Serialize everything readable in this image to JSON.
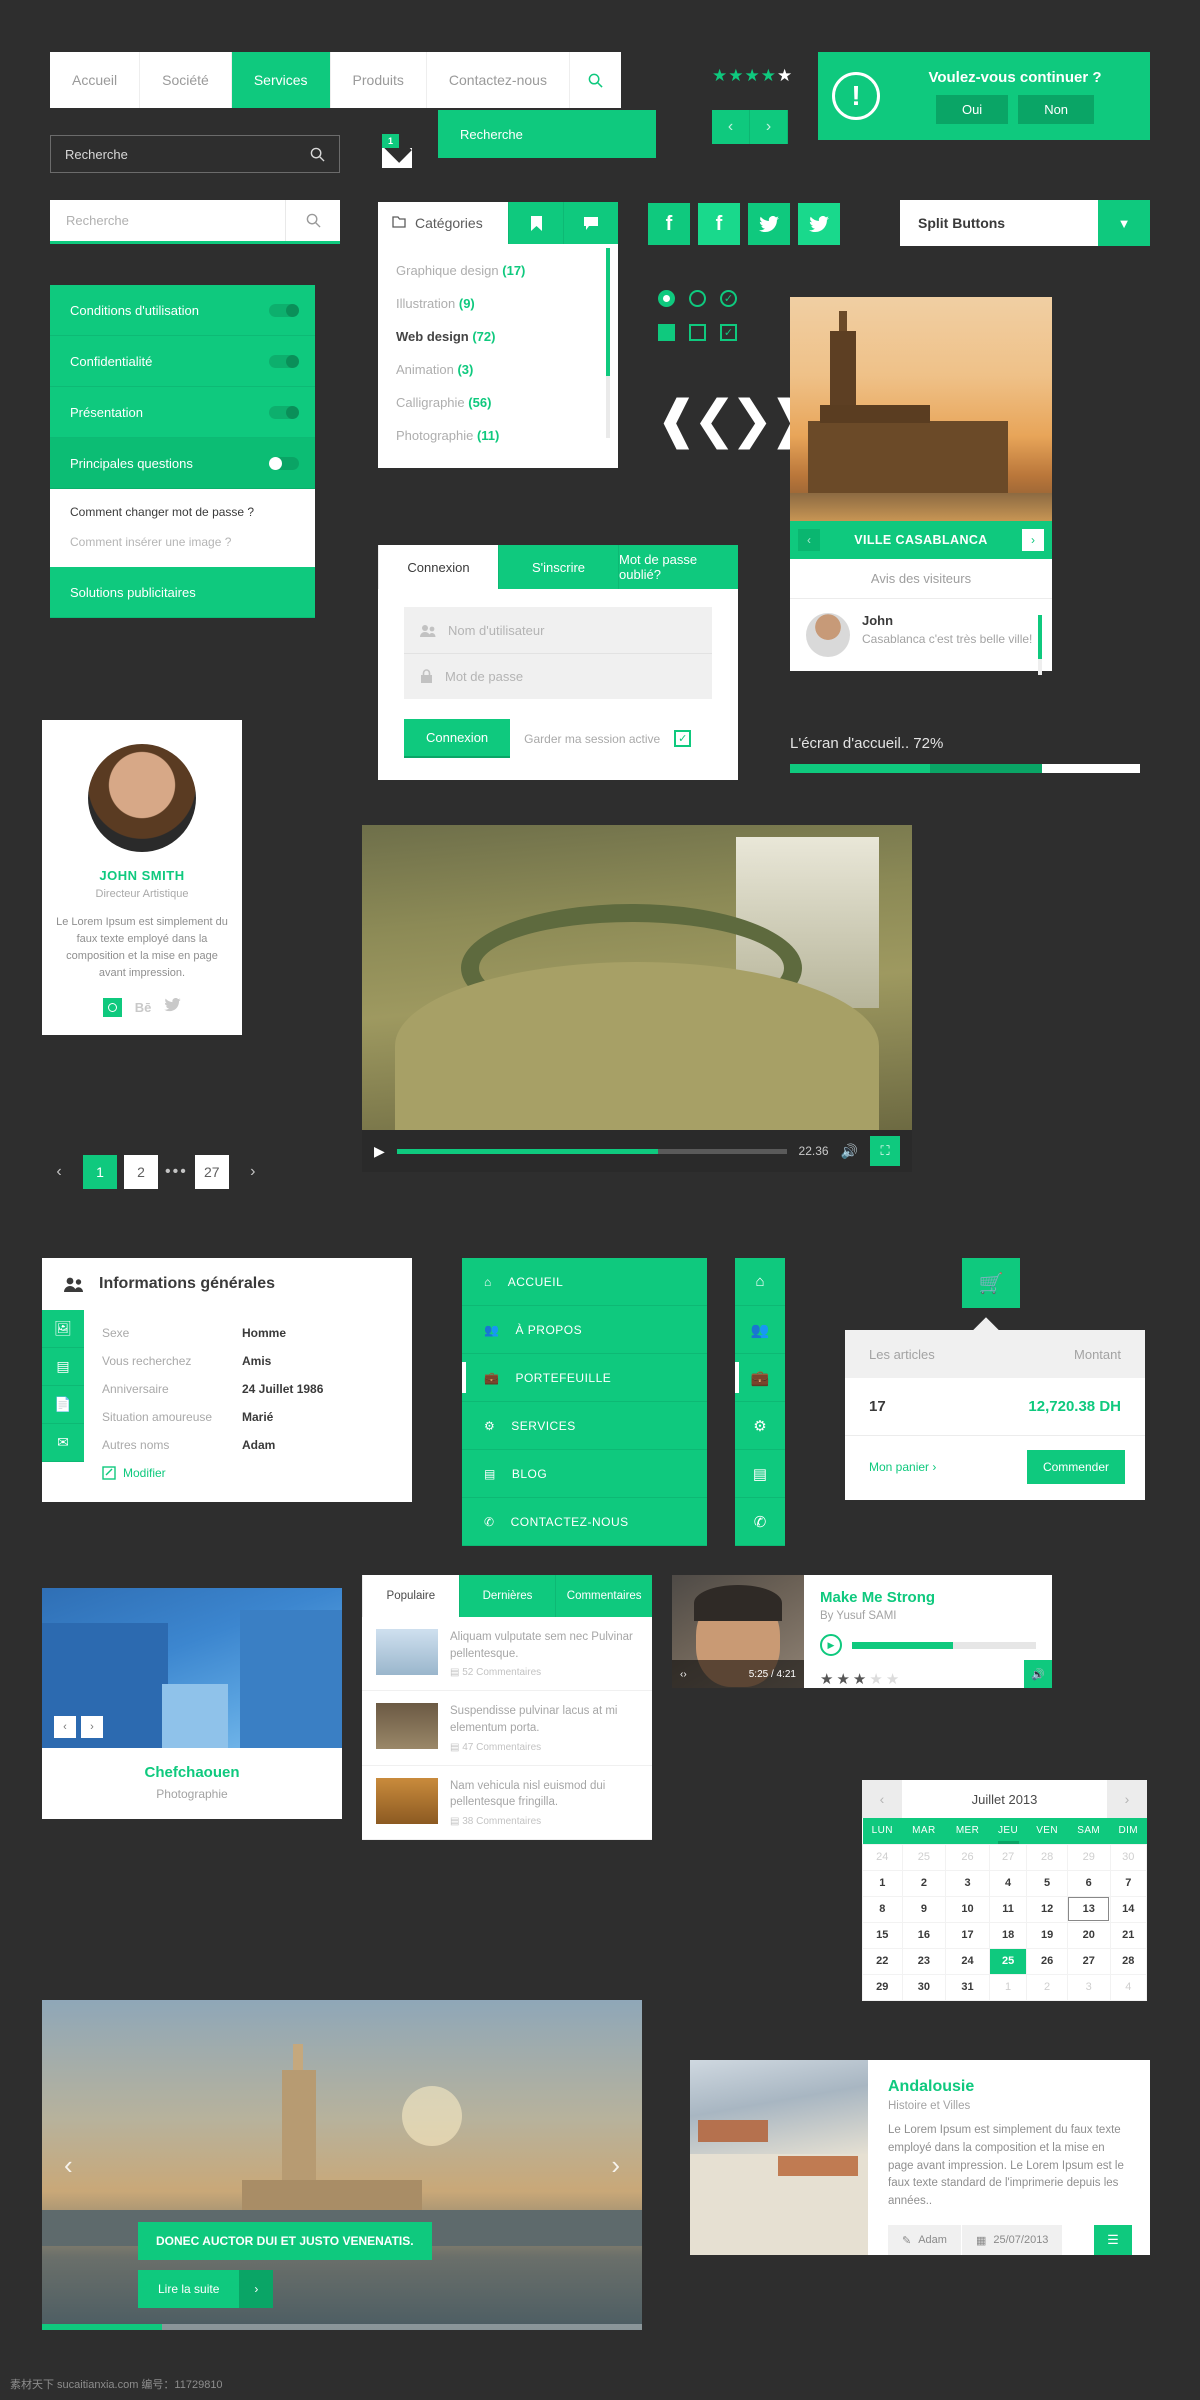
{
  "topnav": {
    "items": [
      "Accueil",
      "Société",
      "Services",
      "Produits",
      "Contactez-nous"
    ],
    "active": "Services",
    "search_icon": "search-icon"
  },
  "rating": {
    "filled": 4,
    "total": 5
  },
  "carousel_arrows": {
    "prev": "‹",
    "next": "›"
  },
  "confirm_dialog": {
    "icon": "!",
    "message": "Voulez-vous continuer ?",
    "yes": "Oui",
    "no": "Non"
  },
  "search_dark": {
    "value": "Recherche",
    "icon": "search-icon"
  },
  "mail_badge": {
    "count": "1"
  },
  "tooltip_search": {
    "label": "Recherche"
  },
  "search_light": {
    "placeholder": "Recherche",
    "icon": "search-icon"
  },
  "accordion": {
    "items": [
      {
        "label": "Conditions d'utilisation",
        "toggle": "off"
      },
      {
        "label": "Confidentialité",
        "toggle": "off"
      },
      {
        "label": "Présentation",
        "toggle": "off"
      },
      {
        "label": "Principales questions",
        "toggle": "on"
      }
    ],
    "panel": {
      "q1": "Comment changer mot de passe ?",
      "q2": "Comment insérer une image ?"
    },
    "footer_item": "Solutions publicitaires"
  },
  "categories": {
    "title": "Catégories",
    "title_icon": "folder-icon",
    "tabs": [
      "bookmark-icon",
      "tag-icon"
    ],
    "items": [
      {
        "label": "Graphique design",
        "count": "(17)",
        "active": false
      },
      {
        "label": "Illustration",
        "count": "(9)",
        "active": false
      },
      {
        "label": "Web design",
        "count": "(72)",
        "active": true
      },
      {
        "label": "Animation",
        "count": "(3)",
        "active": false
      },
      {
        "label": "Calligraphie",
        "count": "(56)",
        "active": false
      },
      {
        "label": "Photographie",
        "count": "(11)",
        "active": false
      }
    ]
  },
  "social": [
    {
      "icon": "facebook-icon",
      "glyph": "f",
      "shade": "dark"
    },
    {
      "icon": "facebook-icon",
      "glyph": "f",
      "shade": "light"
    },
    {
      "icon": "twitter-icon",
      "glyph": "🐦",
      "shade": "dark"
    },
    {
      "icon": "twitter-icon",
      "glyph": "🐦",
      "shade": "light"
    }
  ],
  "split_button": {
    "label": "Split Buttons",
    "caret": "▼"
  },
  "login": {
    "tabs": [
      "Connexion",
      "S'inscrire",
      "Mot de passe oublié?"
    ],
    "active_tab": "Connexion",
    "username_placeholder": "Nom d'utilisateur",
    "password_placeholder": "Mot de passe",
    "submit": "Connexion",
    "keep_logged": "Garder ma session active",
    "keep_checked": true
  },
  "casablanca": {
    "title": "VILLE CASABLANCA",
    "reviews_title": "Avis des visiteurs",
    "review": {
      "name": "John",
      "text": "Casablanca c'est très belle ville!"
    }
  },
  "progress": {
    "label": "L'écran d'accueil.. 72%",
    "percent": 72
  },
  "video": {
    "time": "22.36",
    "progress_percent": 67
  },
  "profile": {
    "name": "JOHN SMITH",
    "role": "Directeur Artistique",
    "bio": "Le Lorem Ipsum est simplement du faux texte employé dans la composition et la mise en page avant impression.",
    "socials": [
      "instagram-icon",
      "behance-icon",
      "twitter-icon"
    ]
  },
  "pagination": {
    "pages": [
      "1",
      "2",
      "27"
    ],
    "active": "1",
    "ellipsis": "•••"
  },
  "infos": {
    "title": "Informations générales",
    "title_icon": "users-icon",
    "rows": [
      {
        "key": "Sexe",
        "value": "Homme"
      },
      {
        "key": "Vous recherchez",
        "value": "Amis"
      },
      {
        "key": "Anniversaire",
        "value": "24 Juillet 1986"
      },
      {
        "key": "Situation amoureuse",
        "value": "Marié"
      },
      {
        "key": "Autres noms",
        "value": "Adam"
      }
    ],
    "edit": "Modifier",
    "rail_icons": [
      "image-icon",
      "film-icon",
      "document-icon",
      "mail-icon"
    ]
  },
  "sidemenu": {
    "items": [
      {
        "label": "ACCUEIL",
        "icon": "home-icon"
      },
      {
        "label": "À PROPOS",
        "icon": "users-icon"
      },
      {
        "label": "PORTEFEUILLE",
        "icon": "briefcase-icon"
      },
      {
        "label": "SERVICES",
        "icon": "gear-icon"
      },
      {
        "label": "BLOG",
        "icon": "list-icon"
      },
      {
        "label": "CONTACTEZ-NOUS",
        "icon": "phone-icon"
      }
    ],
    "active": "PORTEFEUILLE"
  },
  "cart": {
    "button_icon": "cart-icon",
    "col_items": "Les articles",
    "col_amount": "Montant",
    "qty": "17",
    "amount": "12,720.38 DH",
    "my_cart": "Mon panier",
    "checkout": "Commender"
  },
  "chefchaouen": {
    "title": "Chefchaouen",
    "subtitle": "Photographie"
  },
  "popular": {
    "tabs": [
      "Populaire",
      "Dernières",
      "Commentaires"
    ],
    "active_tab": "Populaire",
    "items": [
      {
        "text": "Aliquam vulputate sem nec Pulvinar pellentesque.",
        "meta": "52 Commentaires"
      },
      {
        "text": "Suspendisse pulvinar lacus at mi elementum porta.",
        "meta": "47 Commentaires"
      },
      {
        "text": "Nam vehicula nisl euismod dui pellentesque fringilla.",
        "meta": "38 Commentaires"
      }
    ]
  },
  "music": {
    "title": "Make Me Strong",
    "artist": "By Yusuf SAMI",
    "time": "5:25 / 4:21",
    "stars_filled": 3,
    "stars_total": 5,
    "progress_percent": 55
  },
  "calendar": {
    "title": "Juillet 2013",
    "weekdays": [
      "LUN",
      "MAR",
      "MER",
      "JEU",
      "VEN",
      "SAM",
      "DIM"
    ],
    "selected_weekday": "JEU",
    "weeks": [
      [
        {
          "d": "24",
          "t": "mut"
        },
        {
          "d": "25",
          "t": "mut"
        },
        {
          "d": "26",
          "t": "mut"
        },
        {
          "d": "27",
          "t": "mut"
        },
        {
          "d": "28",
          "t": "mut"
        },
        {
          "d": "29",
          "t": "mut"
        },
        {
          "d": "30",
          "t": "mut"
        }
      ],
      [
        {
          "d": "1",
          "t": ""
        },
        {
          "d": "2",
          "t": ""
        },
        {
          "d": "3",
          "t": ""
        },
        {
          "d": "4",
          "t": ""
        },
        {
          "d": "5",
          "t": ""
        },
        {
          "d": "6",
          "t": ""
        },
        {
          "d": "7",
          "t": ""
        }
      ],
      [
        {
          "d": "8",
          "t": ""
        },
        {
          "d": "9",
          "t": ""
        },
        {
          "d": "10",
          "t": ""
        },
        {
          "d": "11",
          "t": ""
        },
        {
          "d": "12",
          "t": ""
        },
        {
          "d": "13",
          "t": "out"
        },
        {
          "d": "14",
          "t": ""
        }
      ],
      [
        {
          "d": "15",
          "t": ""
        },
        {
          "d": "16",
          "t": ""
        },
        {
          "d": "17",
          "t": ""
        },
        {
          "d": "18",
          "t": ""
        },
        {
          "d": "19",
          "t": ""
        },
        {
          "d": "20",
          "t": ""
        },
        {
          "d": "21",
          "t": ""
        }
      ],
      [
        {
          "d": "22",
          "t": ""
        },
        {
          "d": "23",
          "t": ""
        },
        {
          "d": "24",
          "t": ""
        },
        {
          "d": "25",
          "t": "today"
        },
        {
          "d": "26",
          "t": ""
        },
        {
          "d": "27",
          "t": ""
        },
        {
          "d": "28",
          "t": ""
        }
      ],
      [
        {
          "d": "29",
          "t": ""
        },
        {
          "d": "30",
          "t": ""
        },
        {
          "d": "31",
          "t": ""
        },
        {
          "d": "1",
          "t": "mut"
        },
        {
          "d": "2",
          "t": "mut"
        },
        {
          "d": "3",
          "t": "mut"
        },
        {
          "d": "4",
          "t": "mut"
        }
      ]
    ]
  },
  "slider": {
    "caption": "DONEC AUCTOR DUI ET JUSTO VENENATIS.",
    "more": "Lire la suite",
    "more_arrow": "›",
    "prev": "‹",
    "next": "›"
  },
  "andalousie": {
    "title": "Andalousie",
    "subtitle": "Histoire et Villes",
    "body": "Le Lorem Ipsum est simplement du faux texte employé dans la composition et la mise en page avant impression. Le Lorem Ipsum est le faux texte standard de l'imprimerie depuis les années..",
    "author": "Adam",
    "date": "25/07/2013",
    "menu_icon": "hamburger-icon"
  },
  "footer": {
    "text": "素材天下 sucaitianxia.com  编号：11729810"
  }
}
